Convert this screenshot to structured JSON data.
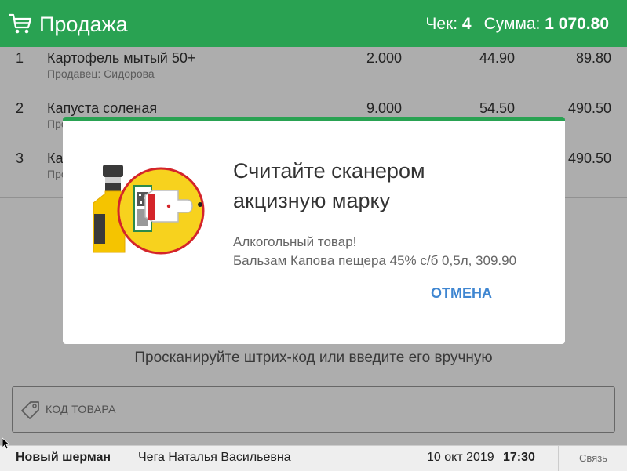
{
  "header": {
    "title": "Продажа",
    "check_label": "Чек:",
    "check_number": "4",
    "sum_label": "Сумма:",
    "sum_value": "1 070.80",
    "icon": "shopping-cart-icon",
    "color": "#29a252"
  },
  "items": [
    {
      "num": "1",
      "name": "Картофель мытый 50+",
      "seller": "Продавец: Сидорова",
      "qty": "2.000",
      "price": "44.90",
      "total": "89.80"
    },
    {
      "num": "2",
      "name": "Капуста соленая",
      "seller": "Про",
      "qty": "9.000",
      "price": "54.50",
      "total": "490.50"
    },
    {
      "num": "3",
      "name": "Ка",
      "seller": "Про",
      "qty": "",
      "price": "",
      "total": "490.50"
    }
  ],
  "hint": "Просканируйте штрих-код или введите его вручную",
  "code_input": {
    "placeholder": "КОД ТОВАРА",
    "icon": "price-tag-icon"
  },
  "status_bar": {
    "store": "Новый шерман",
    "cashier": "Чега Наталья Васильевна",
    "date": "10 окт 2019",
    "time": "17:30",
    "link_button": "Связь"
  },
  "dialog": {
    "title_line1": "Считайте сканером",
    "title_line2": "акцизную марку",
    "subtitle_line1": "Алкогольный товар!",
    "subtitle_line2": "Бальзам Капова пещера 45% с/б 0,5л, 309.90",
    "cancel_label": "ОТМЕНА",
    "icon": "alcohol-bottle-scanner-icon",
    "accent_color": "#29a252",
    "cancel_color": "#3f86d1"
  }
}
